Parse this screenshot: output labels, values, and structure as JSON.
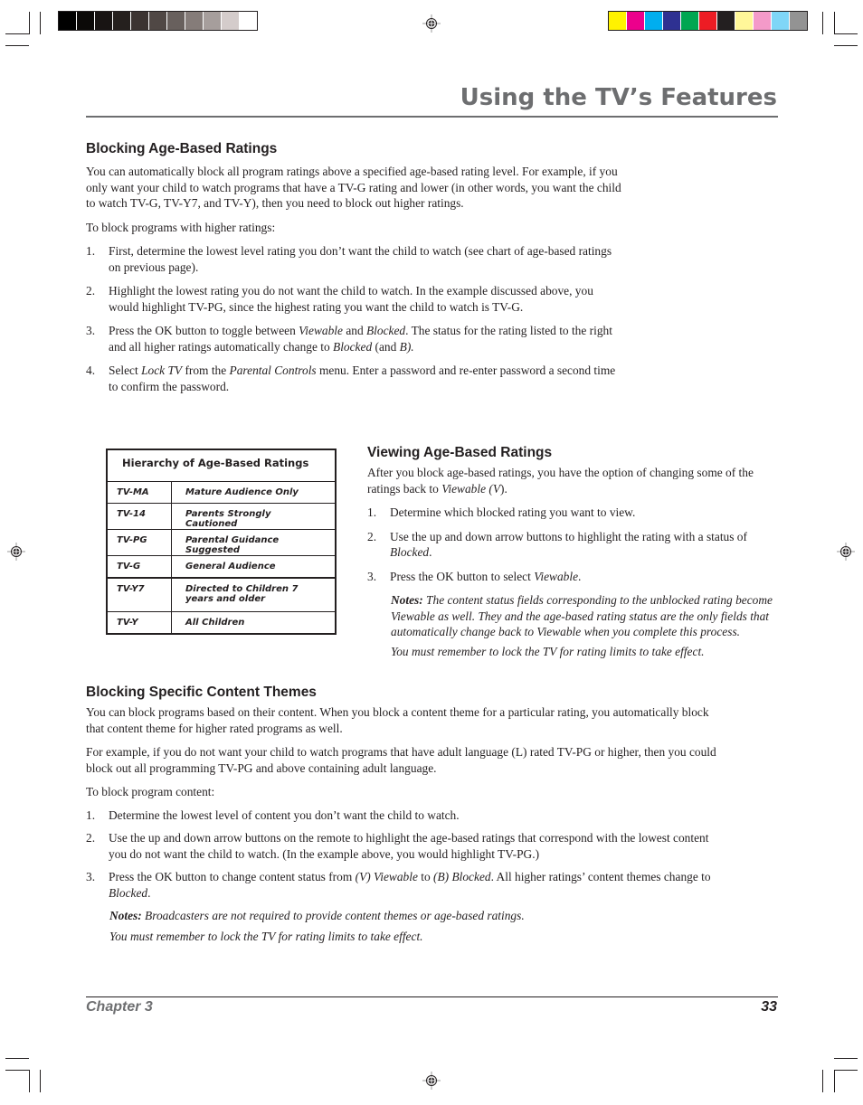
{
  "print_marks": {
    "grayscale_bar": [
      "#000000",
      "#0b0908",
      "#181413",
      "#25201e",
      "#3b3331",
      "#504845",
      "#68605d",
      "#857c79",
      "#a69e9c",
      "#d4cccb",
      "#ffffff"
    ],
    "color_bar": [
      "#fff200",
      "#ec008c",
      "#00aeef",
      "#2e3192",
      "#00a651",
      "#ed1c24",
      "#231f20",
      "#fff799",
      "#f49ac9",
      "#7fd6f7",
      "#939393"
    ]
  },
  "header": {
    "title": "Using the TV’s Features"
  },
  "section_blocking_age": {
    "heading": "Blocking Age-Based Ratings",
    "intro": "You can automatically block all program ratings above a specified age-based rating level. For example, if you only want your child to watch programs that have a TV-G rating and lower (in other words, you want the child to watch TV-G, TV-Y7, and TV-Y), then you need to block out higher ratings.",
    "lead": "To block programs with higher ratings:",
    "steps": [
      {
        "num": "1.",
        "text": "First, determine the lowest level rating you don’t want the child to watch (see chart of age-based ratings on previous page)."
      },
      {
        "num": "2.",
        "text": "Highlight the lowest rating you do not want the child to watch. In the example discussed above, you would highlight TV-PG, since the highest rating you want the child to watch is TV-G."
      },
      {
        "num": "3.",
        "pre": "Press the OK button to toggle between ",
        "i1": "Viewable",
        "mid1": " and ",
        "i2": "Blocked",
        "mid2": ". The status for the rating listed to the right and all higher ratings automatically change to ",
        "i3": "Blocked",
        "mid3": " (and ",
        "i4": "B).",
        "post": ""
      },
      {
        "num": "4.",
        "pre": "Select ",
        "i1": "Lock TV",
        "mid1": " from the ",
        "i2": "Parental Controls",
        "post": " menu. Enter a password and re-enter password a second time to confirm the password."
      }
    ]
  },
  "ratings_table": {
    "title": "Hierarchy of Age-Based Ratings",
    "rows": [
      {
        "code": "TV-MA",
        "desc": "Mature Audience Only"
      },
      {
        "code": "TV-14",
        "desc": "Parents Strongly Cautioned"
      },
      {
        "code": "TV-PG",
        "desc": "Parental Guidance Suggested"
      },
      {
        "code": "TV-G",
        "desc": "General Audience"
      },
      {
        "code": "TV-Y7",
        "desc": "Directed to Children 7 years and older"
      },
      {
        "code": "TV-Y",
        "desc": "All Children"
      }
    ]
  },
  "section_viewing_age": {
    "heading": "Viewing Age-Based Ratings",
    "intro_pre": "After you block age-based ratings, you have the option of changing some of the ratings back to ",
    "intro_i": "Viewable (V",
    "intro_post": ").",
    "steps": [
      {
        "num": "1.",
        "text": "Determine which blocked rating you want to view."
      },
      {
        "num": "2.",
        "pre": "Use the up and down arrow buttons to highlight the rating with a status of ",
        "i1": "Blocked",
        "post": "."
      },
      {
        "num": "3.",
        "pre": "Press the OK button to select ",
        "i1": "Viewable",
        "post": "."
      }
    ],
    "notes_label": "Notes:",
    "notes_text": " The content status fields corresponding to the unblocked rating become Viewable as well. They and the age-based rating status are the only fields that automatically change back to Viewable when you complete this process.",
    "reminder": "You must remember to lock the TV for rating limits to take effect."
  },
  "section_content_themes": {
    "heading": "Blocking Specific Content Themes",
    "para1": "You can block programs based on their content. When you block a content theme for a particular rating, you automatically block that content theme for higher rated programs as well.",
    "para2": "For example, if you do not want your child to watch programs that have adult language (L) rated TV-PG or higher, then you could block out all programming TV-PG and above containing adult language.",
    "lead": "To block program content:",
    "steps": [
      {
        "num": "1.",
        "text": "Determine the lowest level of content you don’t want the child to watch."
      },
      {
        "num": "2.",
        "text": "Use the up and down arrow buttons on the remote to highlight the age-based ratings that correspond with the lowest content you do not want the child to watch.  (In the example above, you would highlight TV-PG.)"
      },
      {
        "num": "3.",
        "pre": "Press the OK button to change content status from ",
        "i1": "(V) Viewable",
        "mid1": " to ",
        "i2": "(B) Blocked",
        "mid2": ". All higher ratings’ content themes change to ",
        "i3": "Blocked",
        "post": "."
      }
    ],
    "notes_label": "Notes:",
    "notes_text": "  Broadcasters are not required to provide content themes or age-based ratings.",
    "reminder": "You must remember to lock the TV for rating limits to take effect."
  },
  "footer": {
    "chapter": "Chapter 3",
    "page_number": "33"
  }
}
